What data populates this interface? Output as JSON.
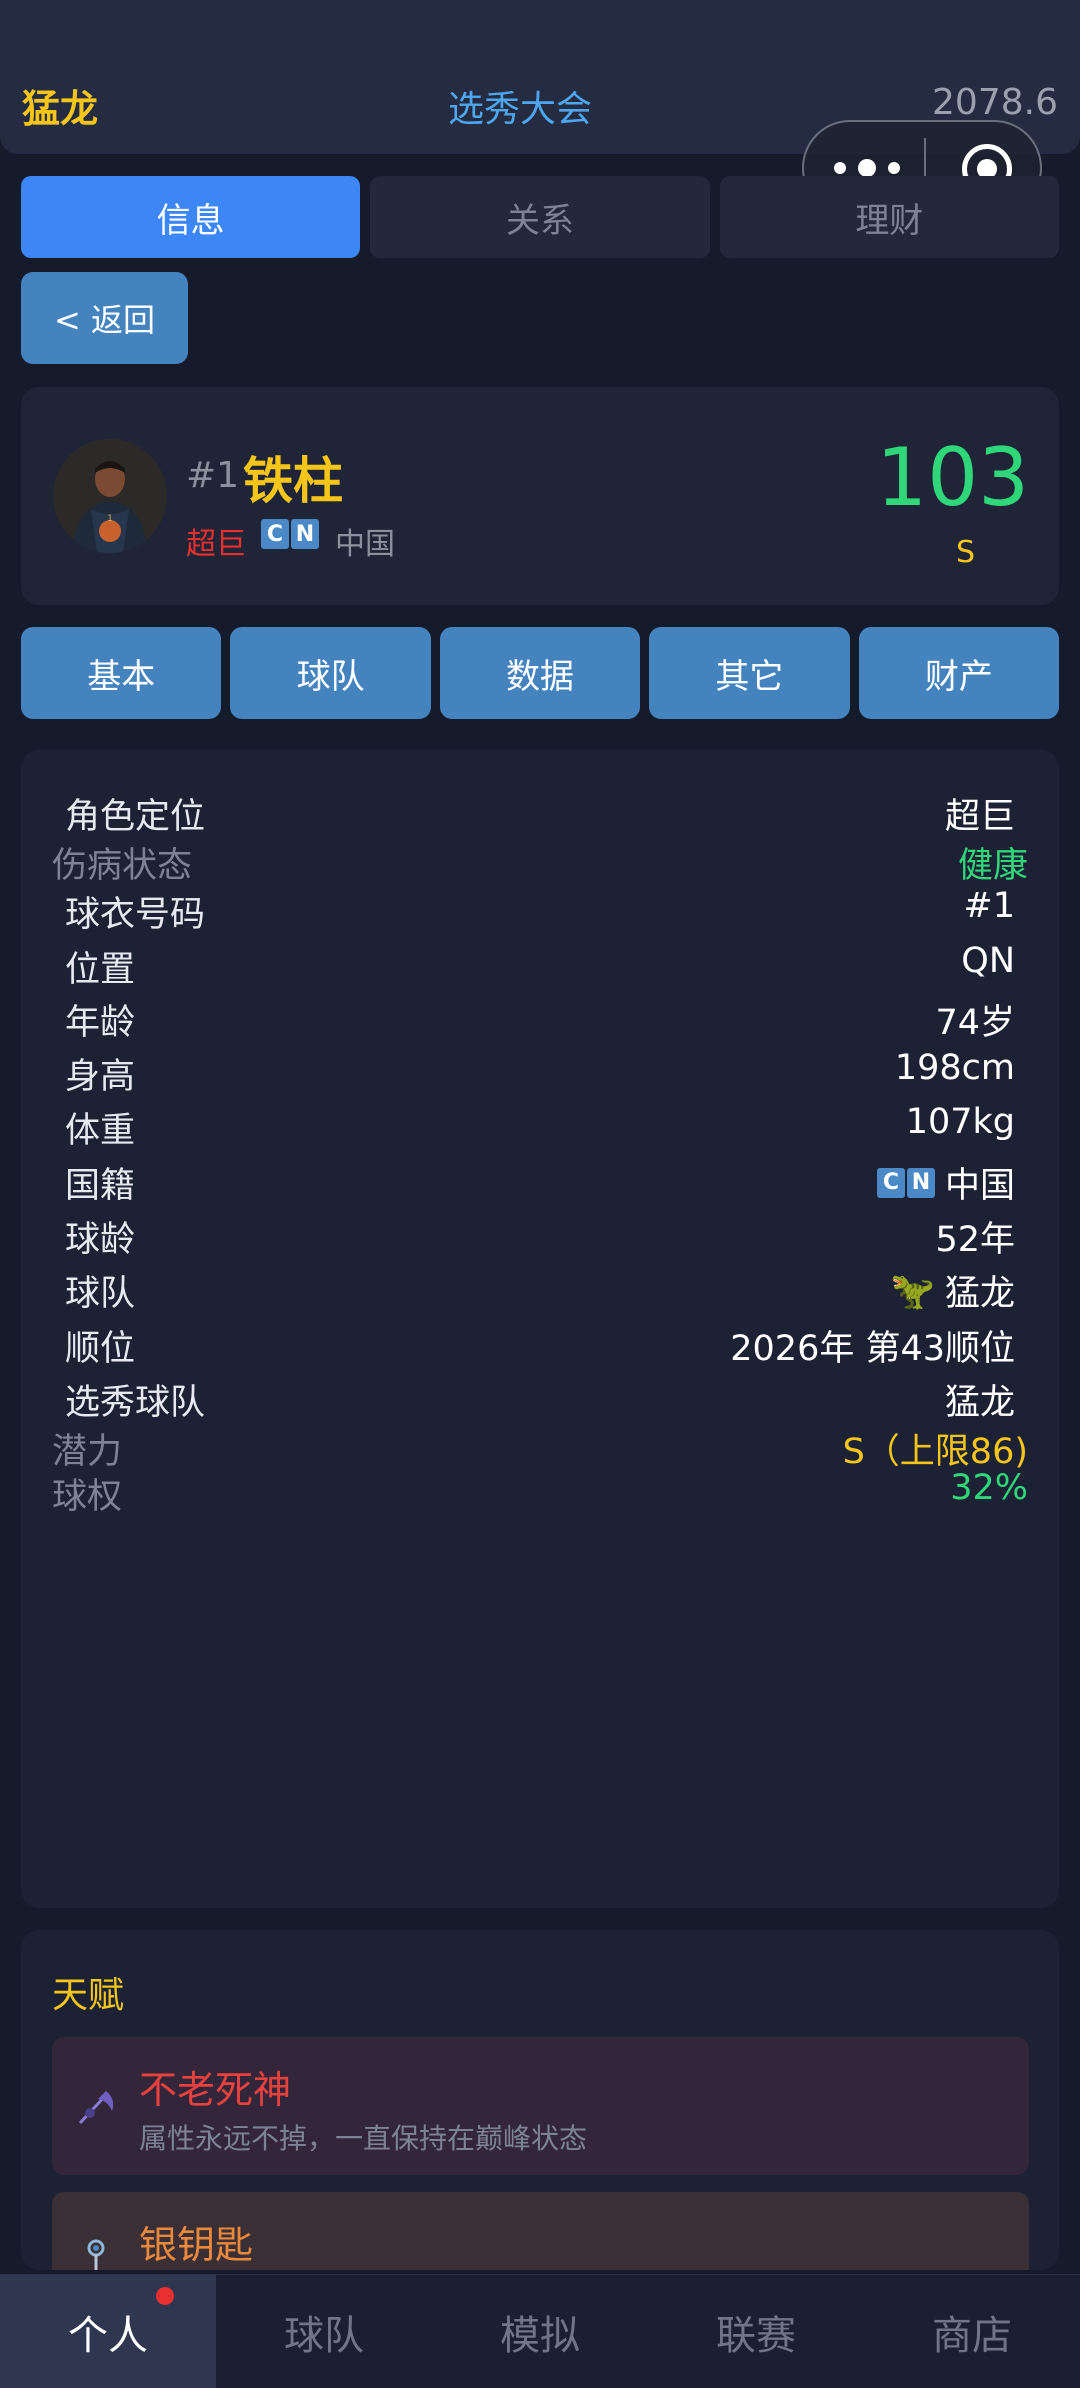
{
  "header": {
    "team": "猛龙",
    "title": "选秀大会",
    "money": "2078.6"
  },
  "tabs": [
    {
      "label": "信息",
      "active": true
    },
    {
      "label": "关系",
      "active": false
    },
    {
      "label": "理财",
      "active": false
    }
  ],
  "back_label": "< 返回",
  "profile": {
    "number": "#1",
    "name": "铁柱",
    "role": "超巨",
    "flag": [
      "C",
      "N"
    ],
    "country": "中国",
    "score": "103",
    "grade": "S"
  },
  "subtabs": [
    "基本",
    "球队",
    "数据",
    "其它",
    "财产"
  ],
  "info": {
    "role": {
      "label": "角色定位",
      "value": "超巨"
    },
    "injury": {
      "label": "伤病状态",
      "value": "健康"
    },
    "jersey": {
      "label": "球衣号码",
      "value": "#1"
    },
    "position": {
      "label": "位置",
      "value": "QN"
    },
    "age": {
      "label": "年龄",
      "value": "74岁"
    },
    "height": {
      "label": "身高",
      "value": "198cm"
    },
    "weight": {
      "label": "体重",
      "value": "107kg"
    },
    "nationality": {
      "label": "国籍",
      "value": "中国"
    },
    "experience": {
      "label": "球龄",
      "value": "52年"
    },
    "team": {
      "label": "球队",
      "value": "猛龙"
    },
    "draft": {
      "label": "顺位",
      "value": "2026年 第43顺位"
    },
    "draft_team": {
      "label": "选秀球队",
      "value": "猛龙"
    },
    "potential": {
      "label": "潜力",
      "value": "S（上限86)"
    },
    "equity": {
      "label": "球权",
      "value": "32%"
    }
  },
  "talent": {
    "title": "天赋",
    "items": [
      {
        "name": "不老死神",
        "desc": "属性永远不掉，一直保持在巅峰状态",
        "color": "#e8413e"
      },
      {
        "name": "银钥匙",
        "desc": "",
        "color": "#e8893e"
      }
    ]
  },
  "nav": [
    {
      "label": "个人",
      "active": true
    },
    {
      "label": "球队",
      "active": false
    },
    {
      "label": "模拟",
      "active": false
    },
    {
      "label": "联赛",
      "active": false
    },
    {
      "label": "商店",
      "active": false
    }
  ]
}
